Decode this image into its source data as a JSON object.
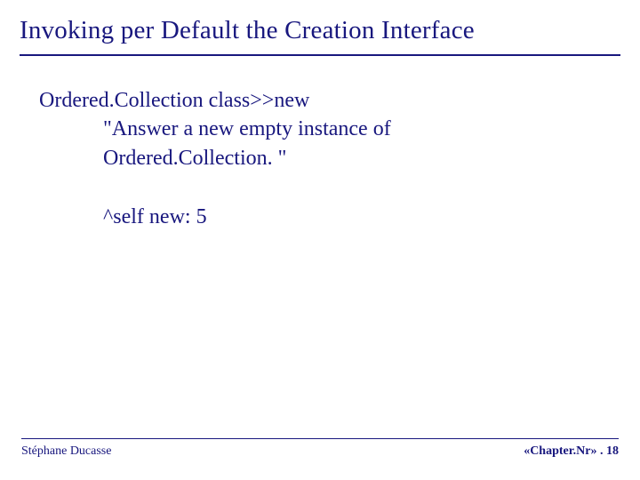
{
  "title": "Invoking per Default the Creation Interface",
  "code": {
    "line1": "Ordered.Collection class>>new",
    "line2": "\"Answer a new empty instance of",
    "line3": "Ordered.Collection. \"",
    "line4": "^self new: 5"
  },
  "footer": {
    "author": "Stéphane Ducasse",
    "pageref": "«Chapter.Nr» . 18"
  }
}
